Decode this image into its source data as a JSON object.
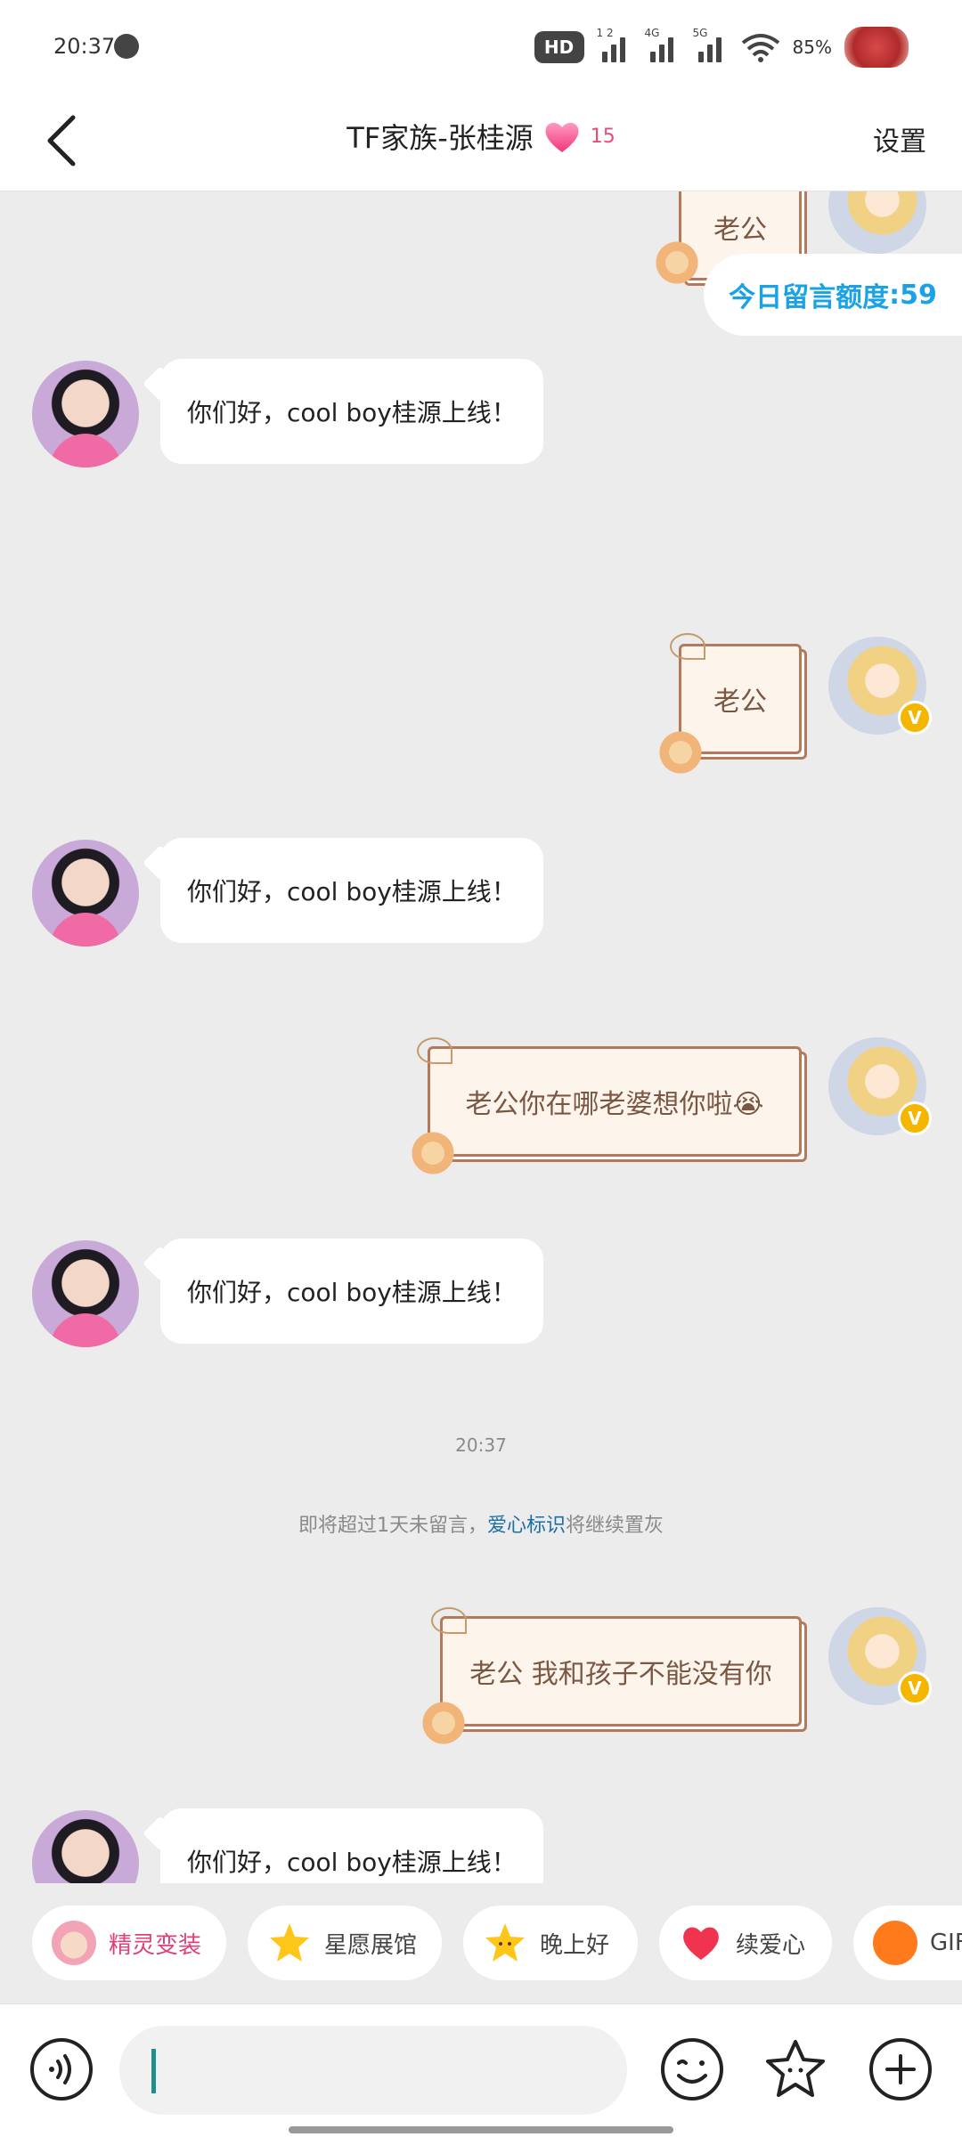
{
  "status_bar": {
    "time": "20:37",
    "hd": "HD",
    "sig1_label": "1 2",
    "sig2_label": "4G",
    "sig3_label": "5G",
    "battery": "85%"
  },
  "header": {
    "title": "TF家族-张桂源",
    "heart_count": "15",
    "settings_label": "设置"
  },
  "quota": {
    "label": "今日留言额度",
    "value": ":59"
  },
  "messages": [
    {
      "side": "right",
      "text": "老公"
    },
    {
      "side": "left",
      "text": "你们好，cool boy桂源上线！"
    },
    {
      "side": "right",
      "text": "老公"
    },
    {
      "side": "left",
      "text": "你们好，cool boy桂源上线！"
    },
    {
      "side": "right",
      "text": "老公你在哪老婆想你啦😭"
    },
    {
      "side": "left",
      "text": "你们好，cool boy桂源上线！"
    },
    {
      "side": "right",
      "text": "老公 我和孩子不能没有你"
    },
    {
      "side": "left",
      "text": "你们好，cool boy桂源上线！"
    }
  ],
  "timestamp": "20:37",
  "notice": {
    "prefix": "即将超过1天未留言，",
    "link": "爱心标识",
    "suffix": "将继续置灰"
  },
  "quick_chips": [
    {
      "label": "精灵变装",
      "icon": "sprite-icon"
    },
    {
      "label": "星愿展馆",
      "icon": "star-icon"
    },
    {
      "label": "晚上好",
      "icon": "star-face-icon"
    },
    {
      "label": "续爱心",
      "icon": "heart-icon"
    },
    {
      "label": "GIF",
      "icon": "gif-icon"
    }
  ],
  "colors": {
    "accent_blue": "#1aa2e6",
    "heart_pink": "#e84d7a",
    "card_border": "#b4785a",
    "card_text": "#7a5743"
  }
}
